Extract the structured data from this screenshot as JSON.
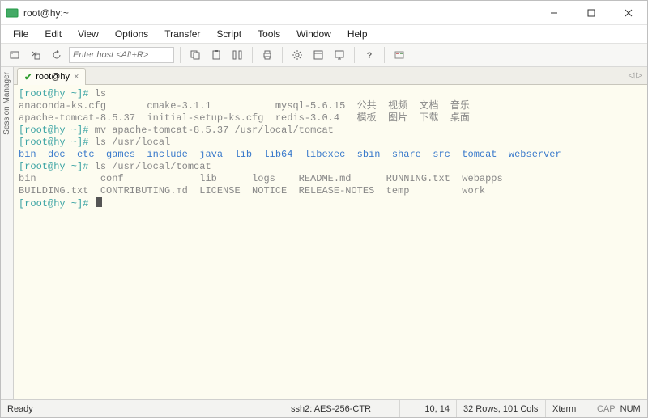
{
  "titlebar": {
    "title": "root@hy:~"
  },
  "menu": {
    "file": "File",
    "edit": "Edit",
    "view": "View",
    "options": "Options",
    "transfer": "Transfer",
    "script": "Script",
    "tools": "Tools",
    "window": "Window",
    "help": "Help"
  },
  "toolbar": {
    "host_placeholder": "Enter host <Alt+R>"
  },
  "tab": {
    "label": "root@hy",
    "close": "×",
    "check": "✔"
  },
  "tabnav": {
    "left": "◁",
    "right": "▷"
  },
  "terminal": {
    "l1_prompt": "[root@hy ~]# ",
    "l1_cmd": "ls",
    "l2": "anaconda-ks.cfg       cmake-3.1.1           mysql-5.6.15  公共  视频  文档  音乐",
    "l3": "apache-tomcat-8.5.37  initial-setup-ks.cfg  redis-3.0.4   模板  图片  下载  桌面",
    "l4_prompt": "[root@hy ~]# ",
    "l4_cmd": "mv apache-tomcat-8.5.37 /usr/local/tomcat",
    "l5_prompt": "[root@hy ~]# ",
    "l5_cmd": "ls /usr/local",
    "l6": "bin  doc  etc  games  include  java  lib  lib64  libexec  sbin  share  src  tomcat  webserver",
    "l7_prompt": "[root@hy ~]# ",
    "l7_cmd": "ls /usr/local/tomcat",
    "l8": "bin           conf             lib      logs    README.md      RUNNING.txt  webapps",
    "l9": "BUILDING.txt  CONTRIBUTING.md  LICENSE  NOTICE  RELEASE-NOTES  temp         work",
    "l10_prompt": "[root@hy ~]# "
  },
  "status": {
    "ready": "Ready",
    "proto": "ssh2: AES-256-CTR",
    "pos": "10, 14",
    "size": "32 Rows, 101 Cols",
    "term": "Xterm",
    "caps": "CAP",
    "num": "NUM"
  },
  "sidebar": {
    "label": "Session Manager"
  }
}
